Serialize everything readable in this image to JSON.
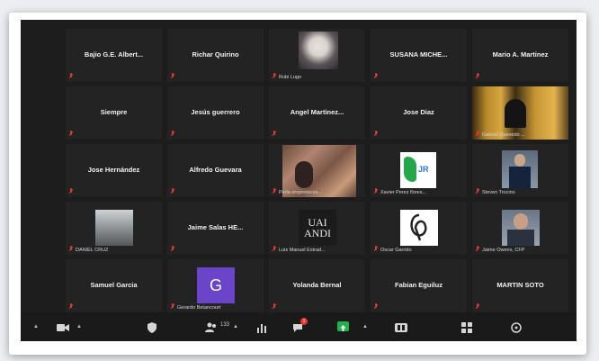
{
  "participants_count": "133",
  "chat_badge": "1",
  "tiles": [
    {
      "id": "bajio",
      "center_name": "Bajio G.E. Albert...",
      "corner_name": ""
    },
    {
      "id": "richar",
      "center_name": "Richar Quirino",
      "corner_name": ""
    },
    {
      "id": "rubi",
      "center_name": "",
      "corner_name": "Rubi Lugo"
    },
    {
      "id": "susana",
      "center_name": "SUSANA MICHE...",
      "corner_name": ""
    },
    {
      "id": "mario",
      "center_name": "Mario A. Martinez",
      "corner_name": ""
    },
    {
      "id": "siempre",
      "center_name": "Siempre",
      "corner_name": ""
    },
    {
      "id": "jesus",
      "center_name": "Jesús guerrero",
      "corner_name": ""
    },
    {
      "id": "angel",
      "center_name": "Angel Martinez...",
      "corner_name": ""
    },
    {
      "id": "jose-diaz",
      "center_name": "Jose Diaz",
      "corner_name": ""
    },
    {
      "id": "gabriel",
      "center_name": "",
      "corner_name": "Gabriel Quevedo ..."
    },
    {
      "id": "jose-h",
      "center_name": "Jose Hernández",
      "corner_name": ""
    },
    {
      "id": "alfredo",
      "center_name": "Alfredo Guevara",
      "corner_name": ""
    },
    {
      "id": "perla",
      "center_name": "",
      "corner_name": "Perla oropretecos..."
    },
    {
      "id": "xavier",
      "center_name": "",
      "corner_name": "Xavier Perez flores..."
    },
    {
      "id": "steven",
      "center_name": "",
      "corner_name": "Steven Trocino"
    },
    {
      "id": "daniel",
      "center_name": "",
      "corner_name": "DANIEL CRUZ"
    },
    {
      "id": "jaime-salas",
      "center_name": "Jaime Salas HE...",
      "corner_name": ""
    },
    {
      "id": "luis",
      "center_name": "",
      "corner_name": "Luis Manuel Estrad..."
    },
    {
      "id": "oscar",
      "center_name": "",
      "corner_name": "Oscar Garrido"
    },
    {
      "id": "jaime-owens",
      "center_name": "",
      "corner_name": "Jaime Owens, CFP"
    },
    {
      "id": "samuel",
      "center_name": "Samuel Garcia",
      "corner_name": ""
    },
    {
      "id": "gerardo",
      "center_name": "",
      "corner_name": "Gerardo Betancourt"
    },
    {
      "id": "yolanda",
      "center_name": "Yolanda Bernal",
      "corner_name": ""
    },
    {
      "id": "fabian",
      "center_name": "Fabian Eguiluz",
      "corner_name": ""
    },
    {
      "id": "martin",
      "center_name": "MARTIN SOTO",
      "corner_name": ""
    }
  ],
  "avatars": {
    "gerardo_letter": "G",
    "xavier_logo": "JR",
    "luis_text": "UAI\nANDI"
  },
  "colors": {
    "muted_mic": "#e0392b",
    "gerardo_avatar": "#6a45c9",
    "share_green": "#22b14c",
    "badge_red": "#e0392b"
  }
}
